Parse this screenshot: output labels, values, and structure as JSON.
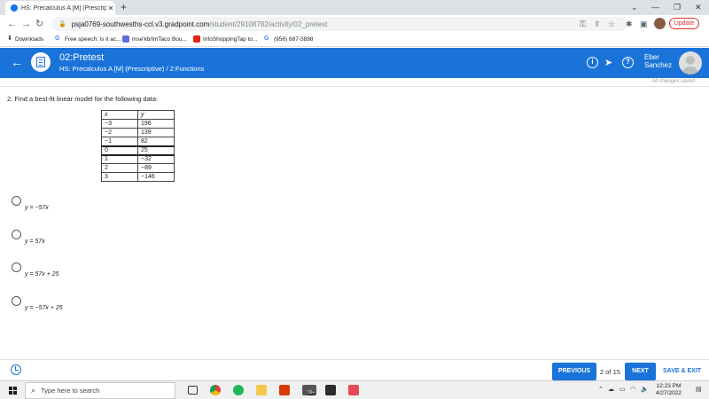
{
  "browser": {
    "tab_title": "HS: Precalculus A [M] (Prescripti...",
    "url_host": "psja0769-southwesths-ccl.v3.gradpoint.com",
    "url_path": "/student/29108782/activity/02_pretest",
    "update_label": "Update",
    "bookmarks": [
      {
        "label": "Downloads"
      },
      {
        "label": "Free speech: is it ac..."
      },
      {
        "label": "mse'kb/ImTaco Bou..."
      },
      {
        "label": "InfoShoppingTap to..."
      },
      {
        "label": "(956) 687-5898"
      }
    ]
  },
  "header": {
    "title": "02:Pretest",
    "subtitle": "HS: Precalculus A [M] (Prescriptive) / 2:Functions",
    "user_first": "Eber",
    "user_last": "Sanchez"
  },
  "status": {
    "saved": "All changes saved"
  },
  "question": {
    "text": "2. Find a best-fit linear model for the following data:",
    "table": {
      "headers": [
        "x",
        "y"
      ],
      "rows": [
        [
          "−3",
          "196"
        ],
        [
          "−2",
          "139"
        ],
        [
          "−1",
          "82"
        ],
        [
          "0",
          "25"
        ],
        [
          "1",
          "−32"
        ],
        [
          "2",
          "−89"
        ],
        [
          "3",
          "−146"
        ]
      ]
    },
    "options": [
      "y = −57x",
      "y = 57x",
      "y = 57x + 25",
      "y = −57x + 25"
    ]
  },
  "footer": {
    "previous": "PREVIOUS",
    "page": "2 of 15",
    "next": "NEXT",
    "save_exit": "SAVE & EXIT"
  },
  "taskbar": {
    "search_placeholder": "Type here to search",
    "time": "12:23 PM",
    "date": "4/27/2022",
    "badge": "99+"
  },
  "colors": {
    "accent": "#1a73d9"
  }
}
